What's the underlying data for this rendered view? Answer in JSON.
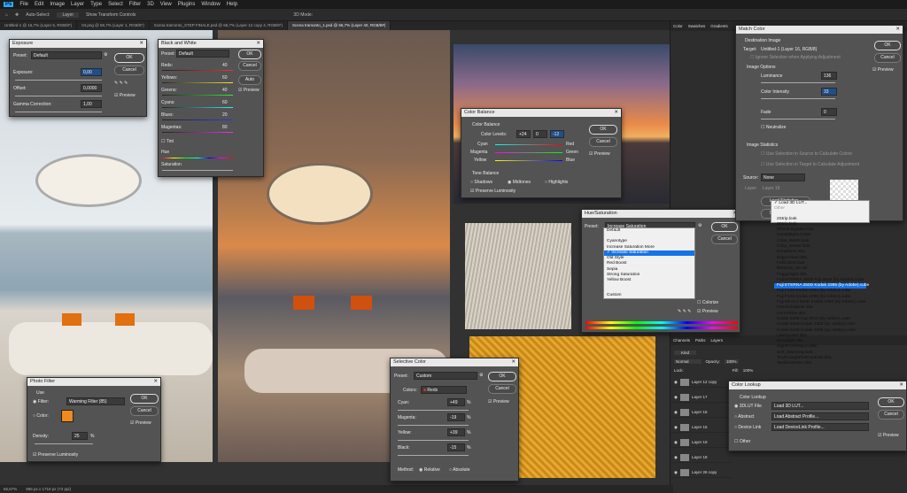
{
  "menubar": {
    "logo": "Ps",
    "items": [
      "File",
      "Edit",
      "Image",
      "Layer",
      "Type",
      "Select",
      "Filter",
      "3D",
      "View",
      "Plugins",
      "Window",
      "Help"
    ]
  },
  "options": {
    "auto_select": "Auto-Select:",
    "layer": "Layer",
    "transform": "Show Transform Controls",
    "mode3d": "3D Mode:"
  },
  "tabs": [
    "Untitled-1 @ 16,7% (Layer 6, RGB/8*)",
    "04.png @ 66,7% (Layer 1, RGB/8*)",
    "Scena tramonto_STEP FINALE.psd @ 66,7% (Layer 12 copy 4, RGB/8*)",
    "Scena tramonto_1.psd @ 66,7% (Layer 40, RGB/8#)"
  ],
  "status": {
    "zoom": "66,67%",
    "size": "966 px x 1716 px (72 ppi)"
  },
  "exposure": {
    "title": "Exposure",
    "preset_label": "Preset:",
    "preset": "Default",
    "exposure_label": "Exposure:",
    "exposure": "0,00",
    "offset_label": "Offset:",
    "offset": "0,0000",
    "gamma_label": "Gamma Correction:",
    "gamma": "1,00",
    "ok": "OK",
    "cancel": "Cancel",
    "preview": "Preview"
  },
  "bw": {
    "title": "Black and White",
    "preset_label": "Preset:",
    "preset": "Default",
    "ok": "OK",
    "cancel": "Cancel",
    "auto": "Auto",
    "preview": "Preview",
    "rows": [
      {
        "name": "Reds:",
        "val": "40"
      },
      {
        "name": "Yellows:",
        "val": "60"
      },
      {
        "name": "Greens:",
        "val": "40"
      },
      {
        "name": "Cyans:",
        "val": "60"
      },
      {
        "name": "Blues:",
        "val": "20"
      },
      {
        "name": "Magentas:",
        "val": "80"
      }
    ],
    "tint": "Tint",
    "hue": "Hue",
    "saturation": "Saturation"
  },
  "colorbal": {
    "title": "Color Balance",
    "section": "Color Balance",
    "levels_label": "Color Levels:",
    "l1": "+24",
    "l2": "0",
    "l3": "-12",
    "cyan": "Cyan",
    "red": "Red",
    "magenta": "Magenta",
    "green": "Green",
    "yellow": "Yellow",
    "blue": "Blue",
    "tone": "Tone Balance",
    "shadows": "Shadows",
    "midtones": "Midtones",
    "highlights": "Highlights",
    "preserve": "Preserve Luminosity",
    "ok": "OK",
    "cancel": "Cancel",
    "preview": "Preview"
  },
  "huesat": {
    "title": "Hue/Saturation",
    "preset_label": "Preset:",
    "preset": "Increase Saturation",
    "ok": "OK",
    "cancel": "Cancel",
    "colorize": "Colorize",
    "preview": "Preview",
    "menu": [
      "Default",
      "Cyanotype",
      "Increase Saturation More",
      "Increase Saturation",
      "Old Style",
      "Red Boost",
      "Sepia",
      "Strong Saturation",
      "Yellow Boost",
      "Custom"
    ],
    "selected": "Increase Saturation"
  },
  "selcolor": {
    "title": "Selective Color",
    "preset_label": "Preset:",
    "preset": "Custom",
    "colors_label": "Colors:",
    "colors": "Reds",
    "cyan_label": "Cyan:",
    "cyan": "+49",
    "magenta_label": "Magenta:",
    "magenta": "-19",
    "yellow_label": "Yellow:",
    "yellow": "+39",
    "black_label": "Black:",
    "black": "-15",
    "pct": "%",
    "method": "Method:",
    "relative": "Relative",
    "absolute": "Absolute",
    "ok": "OK",
    "cancel": "Cancel",
    "preview": "Preview"
  },
  "photofilter": {
    "title": "Photo Filter",
    "use": "Use",
    "filter_label": "Filter:",
    "filter": "Warming Filter (85)",
    "color_label": "Color:",
    "density_label": "Density:",
    "density": "25",
    "pct": "%",
    "preserve": "Preserve Luminosity",
    "ok": "OK",
    "cancel": "Cancel",
    "preview": "Preview",
    "swatch": "#f08a1a"
  },
  "matchcolor": {
    "title": "Match Color",
    "dest": "Destination Image",
    "target_label": "Target:",
    "target": "Untitled-1 (Layer 16, RGB/8)",
    "ignore": "Ignore Selection when Applying Adjustment",
    "image_options": "Image Options",
    "luminance_label": "Luminance",
    "luminance": "136",
    "intensity_label": "Color Intensity",
    "intensity": "33",
    "fade_label": "Fade",
    "fade": "0",
    "neutralize": "Neutralize",
    "stats": "Image Statistics",
    "use_src": "Use Selection in Source to Calculate Colors",
    "use_tgt": "Use Selection in Target to Calculate Adjustment",
    "source_label": "Source:",
    "source": "None",
    "layer_label": "Layer:",
    "layer": "Layer 19",
    "load": "Load Statistics...",
    "save": "Save Statistics...",
    "ok": "OK",
    "cancel": "Cancel",
    "preview": "Preview"
  },
  "lut": {
    "top": [
      "Load 3D LUT...",
      "Other"
    ],
    "items": [
      "2Strip.look",
      "3Strip.look",
      "Bleach Bypass.look",
      "Candlelight.CUBE",
      "Crisp_Warm.look",
      "Crisp_Winter.look",
      "DropBlues.3DL",
      "EdgyAmber.3DL",
      "FallColors.look",
      "filmstock_50.3dl",
      "FoggyNight.3DL",
      "Fuji ETERNA 250D Fuji 3510 (by Adobe).cube",
      "Fuji ETERNA 250D Kodak 2395 (by Adobe).cube",
      "Fuji F125 Kodak 2393 (by Adobe).cube",
      "Fuji F125 Kodak 2395 (by Adobe).cube",
      "Fuji REALA 500D Kodak 2393 (by Adobe).cube",
      "FuturisticBleak.3DL",
      "HorrorBlue.3DL",
      "Kodak 5205 Fuji 3510 (by Adobe).cube",
      "Kodak 5218 Kodak 2383 (by Adobe).cube",
      "Kodak 5218 Kodak 2395 (by Adobe).cube",
      "LateSunset.3DL",
      "Moonlight.3DL",
      "NightFromDay.CUBE",
      "Soft_Warming.look",
      "TealOrangePlusContrast.3DL",
      "TensionGreen.3DL"
    ],
    "selected": "Fuji ETERNA 250D Kodak 2395 (by Adobe).cube"
  },
  "colorlookup": {
    "title": "Color Lookup",
    "section": "Color Lookup",
    "file3d": "3DLUT File",
    "abstract": "Abstract",
    "devlink": "Device Link",
    "other": "Other",
    "file3d_val": "Load 3D LUT...",
    "abstract_val": "Load Abstract Profile...",
    "devlink_val": "Load DeviceLink Profile...",
    "ok": "OK",
    "cancel": "Cancel",
    "preview": "Preview"
  },
  "panels": {
    "tabs1": [
      "Color",
      "Swatches",
      "Gradients"
    ],
    "tabs2": [
      "Channels",
      "Paths",
      "Layers"
    ],
    "kind": "Kind",
    "normal": "Normal",
    "opacity_label": "Opacity:",
    "opacity": "100%",
    "fill_label": "Fill:",
    "fill": "100%",
    "lock": "Lock:",
    "layers": [
      "Layer 12 copy",
      "Layer 17",
      "Layer 16",
      "Layer 15",
      "Layer 19",
      "Layer 18",
      "Layer 26 copy"
    ]
  }
}
